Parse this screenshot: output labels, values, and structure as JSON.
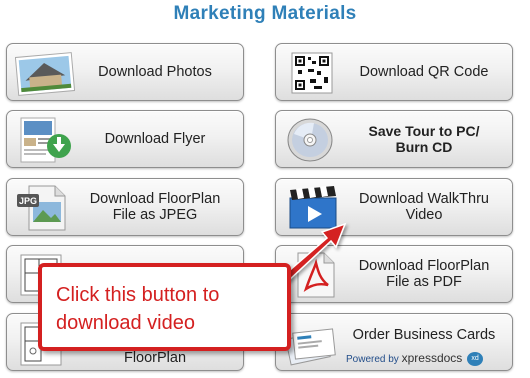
{
  "title": "Marketing Materials",
  "buttons": {
    "photos": "Download Photos",
    "qr": "Download QR Code",
    "flyer": "Download Flyer",
    "save_tour": "Save Tour to PC/\nBurn CD",
    "floorplan_jpeg": "Download FloorPlan\nFile as JPEG",
    "walkthru": "Download WalkThru\nVideo",
    "floorplan_pdf": "Download FloorPlan\nFile as PDF",
    "floorplan": "FloorPlan",
    "business_cards": "Order Business Cards",
    "powered_by": "Powered by",
    "powered_brand": "xpressdocs",
    "jpg_badge": "JPG"
  },
  "callout": {
    "text": "Click this button to\ndownload video"
  },
  "colors": {
    "title": "#2f80b8",
    "callout": "#d42020"
  }
}
